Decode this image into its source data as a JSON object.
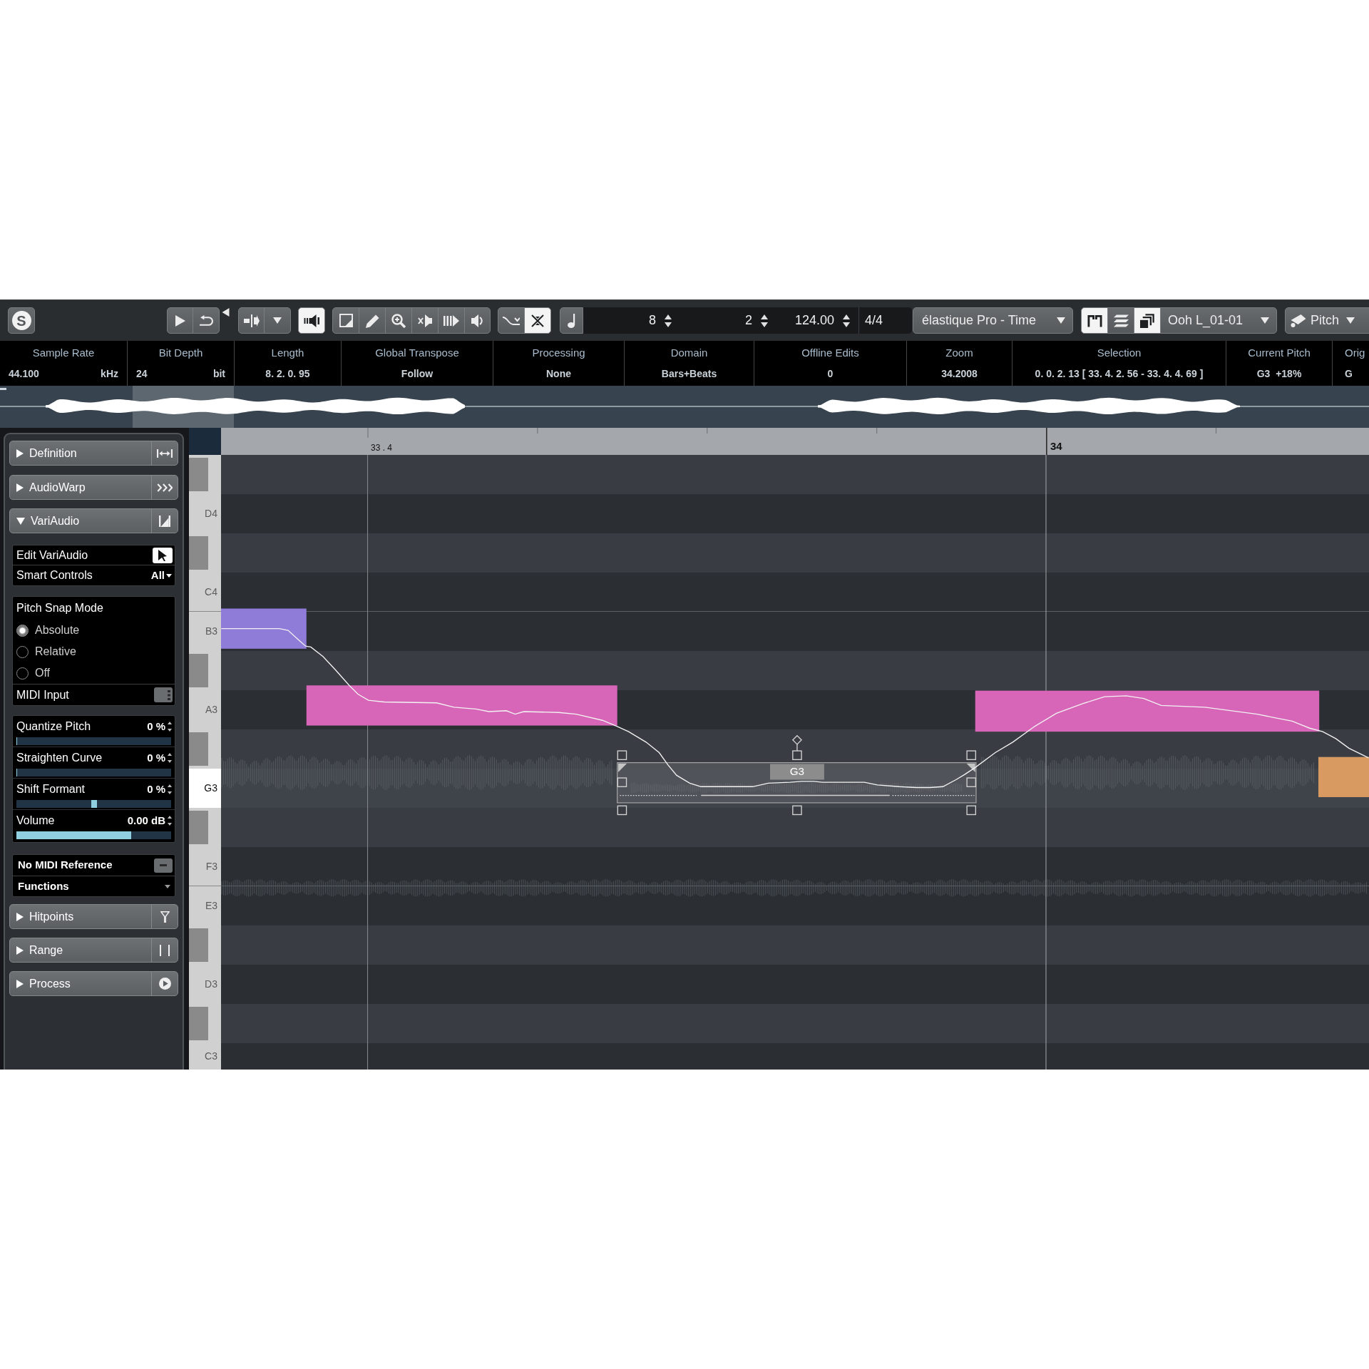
{
  "toolbar": {
    "logo": "S",
    "groups": [
      {
        "buttons": [
          {
            "on": false
          },
          {
            "on": false
          }
        ]
      },
      {
        "buttons": [
          {
            "on": false
          },
          {
            "on": false
          }
        ]
      },
      {
        "buttons": [
          {
            "on": true
          }
        ]
      },
      {
        "buttons": [
          {
            "on": false
          },
          {
            "on": false
          },
          {
            "on": false
          },
          {
            "on": false
          },
          {
            "on": false
          },
          {
            "on": false
          }
        ]
      },
      {
        "buttons": [
          {
            "on": false
          },
          {
            "on": true
          }
        ]
      },
      {
        "buttons": [
          {
            "on": false
          }
        ]
      }
    ],
    "fields": [
      {
        "value": "8",
        "spin": true
      },
      {
        "value": "2",
        "spin": true
      },
      {
        "value": "124.00",
        "spin": true
      },
      {
        "value": "4/4",
        "spin": false
      }
    ],
    "algorithm": "élastique Pro - Time",
    "view_buttons": [
      {
        "on": true
      },
      {
        "on": false
      },
      {
        "on": true
      }
    ],
    "event": "Ooh L_01-01",
    "tool": "Pitch"
  },
  "info": [
    {
      "label": "Sample Rate",
      "value": "44.100",
      "unit": "kHz"
    },
    {
      "label": "Bit Depth",
      "value": "24",
      "unit": "bit"
    },
    {
      "label": "Length",
      "value": "8. 2. 0. 95"
    },
    {
      "label": "Global Transpose",
      "value": "Follow"
    },
    {
      "label": "Processing",
      "value": "None"
    },
    {
      "label": "Domain",
      "value": "Bars+Beats"
    },
    {
      "label": "Offline Edits",
      "value": "0"
    },
    {
      "label": "Zoom",
      "value": "34.2008"
    },
    {
      "label": "Selection",
      "value": "0. 0. 2. 13 [ 33. 4. 2. 56 - 33. 4. 4. 69 ]"
    },
    {
      "label": "Current Pitch",
      "value": "G3  +18%"
    },
    {
      "label": "Orig",
      "value": "G"
    }
  ],
  "inspector": {
    "sections": [
      {
        "title": "Definition",
        "expanded": false
      },
      {
        "title": "AudioWarp",
        "expanded": false
      },
      {
        "title": "VariAudio",
        "expanded": true,
        "body": {
          "edit": {
            "label": "Edit VariAudio",
            "on": true
          },
          "smart_controls": {
            "label": "Smart Controls",
            "value": "All"
          },
          "pitch_snap": {
            "title": "Pitch Snap Mode",
            "options": [
              {
                "label": "Absolute",
                "selected": true
              },
              {
                "label": "Relative",
                "selected": false
              },
              {
                "label": "Off",
                "selected": false
              }
            ]
          },
          "midi_input": {
            "label": "MIDI Input",
            "on": false
          },
          "params": [
            {
              "label": "Quantize Pitch",
              "reading": "0 %",
              "kind": "fill",
              "level": 0
            },
            {
              "label": "Straighten Curve",
              "reading": "0 %",
              "kind": "fill",
              "level": 0
            },
            {
              "label": "Shift Formant",
              "reading": "0 %",
              "kind": "thumb",
              "level": 0.5
            },
            {
              "label": "Volume",
              "reading": "0.00 dB",
              "kind": "fill",
              "level": 0.74
            }
          ],
          "midi_reference": {
            "label": "No MIDI Reference"
          },
          "functions": {
            "label": "Functions"
          }
        }
      },
      {
        "title": "Hitpoints",
        "expanded": false
      },
      {
        "title": "Range",
        "expanded": false
      },
      {
        "title": "Process",
        "expanded": false
      }
    ]
  },
  "ruler": {
    "markers": [
      {
        "label": "33 . 4",
        "kind": "beat"
      },
      {
        "label": "34",
        "kind": "bar"
      }
    ]
  },
  "piano_keys": [
    {
      "kind": "sharp",
      "selected": false
    },
    {
      "kind": "natural",
      "label": "D4",
      "selected": false
    },
    {
      "kind": "sharp",
      "selected": false
    },
    {
      "kind": "natural",
      "label": "C4",
      "selected": false
    },
    {
      "kind": "natural",
      "label": "B3",
      "selected": false
    },
    {
      "kind": "sharp",
      "selected": false
    },
    {
      "kind": "natural",
      "label": "A3",
      "selected": false
    },
    {
      "kind": "sharp",
      "selected": false
    },
    {
      "kind": "natural",
      "label": "G3",
      "selected": true
    },
    {
      "kind": "sharp",
      "selected": false
    },
    {
      "kind": "natural",
      "label": "F3",
      "selected": false
    },
    {
      "kind": "natural",
      "label": "E3",
      "selected": false
    },
    {
      "kind": "sharp",
      "selected": false
    },
    {
      "kind": "natural",
      "label": "D3",
      "selected": false
    },
    {
      "kind": "sharp",
      "selected": false
    },
    {
      "kind": "natural",
      "label": "C3",
      "selected": false
    }
  ],
  "notes": [
    {
      "color": "#8f7bd8",
      "selected": false
    },
    {
      "color": "#d866b8",
      "selected": false
    },
    {
      "label": "G3",
      "selected": true
    },
    {
      "color": "#d866b8",
      "selected": false
    },
    {
      "color": "#d99a62",
      "selected": false
    }
  ]
}
